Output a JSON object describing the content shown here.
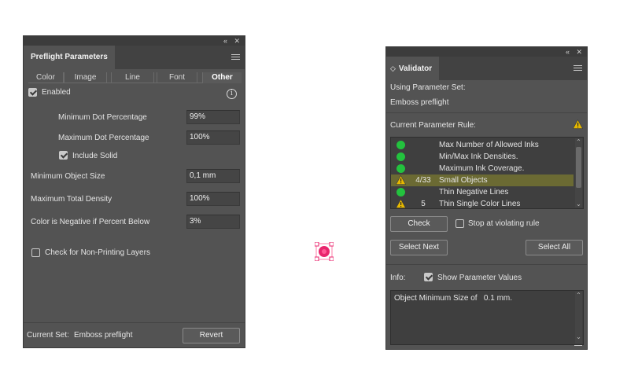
{
  "preflight": {
    "title": "Preflight Parameters",
    "collapse_glyph": "«",
    "close_glyph": "✕",
    "categories": [
      "Color",
      "Image",
      "Line",
      "Font",
      "Other"
    ],
    "active_category": "Other",
    "enabled_label": "Enabled",
    "info_glyph": "i",
    "min_dot_label": "Minimum Dot Percentage",
    "min_dot_value": "99%",
    "max_dot_label": "Maximum Dot Percentage",
    "max_dot_value": "100%",
    "include_solid_label": "Include Solid",
    "min_object_label": "Minimum Object Size",
    "min_object_value": "0,1 mm",
    "max_density_label": "Maximum Total Density",
    "max_density_value": "100%",
    "negative_label": "Color is Negative if Percent Below",
    "negative_value": "3%",
    "non_printing_label": "Check for Non-Printing Layers",
    "current_set_label": "Current Set:",
    "current_set_value": "Emboss preflight",
    "revert_label": "Revert"
  },
  "validator": {
    "title": "Validator",
    "title_glyph": "◇",
    "collapse_glyph": "«",
    "close_glyph": "✕",
    "using_set_label": "Using Parameter Set:",
    "using_set_value": "Emboss preflight",
    "current_rule_label": "Current Parameter Rule:",
    "rules": [
      {
        "status": "ok",
        "count": "",
        "name": "Max Number of Allowed Inks"
      },
      {
        "status": "ok",
        "count": "",
        "name": "Min/Max Ink Densities."
      },
      {
        "status": "ok",
        "count": "",
        "name": "Maximum Ink Coverage."
      },
      {
        "status": "warning",
        "count": "4/33",
        "name": "Small Objects",
        "selected": true
      },
      {
        "status": "ok",
        "count": "",
        "name": "Thin Negative Lines"
      },
      {
        "status": "warning",
        "count": "5",
        "name": "Thin Single Color Lines"
      }
    ],
    "check_label": "Check",
    "stop_label": "Stop at violating rule",
    "select_next_label": "Select Next",
    "select_all_label": "Select All",
    "info_label": "Info:",
    "show_values_label": "Show Parameter Values",
    "info_text": "Object Minimum Size of   0.1 mm."
  },
  "colors": {
    "panel_bg": "#535353",
    "status_ok": "#23c23e",
    "status_warning": "#e6b800",
    "selected_row": "#6b6a33",
    "cursor_marker": "#e8266d"
  }
}
